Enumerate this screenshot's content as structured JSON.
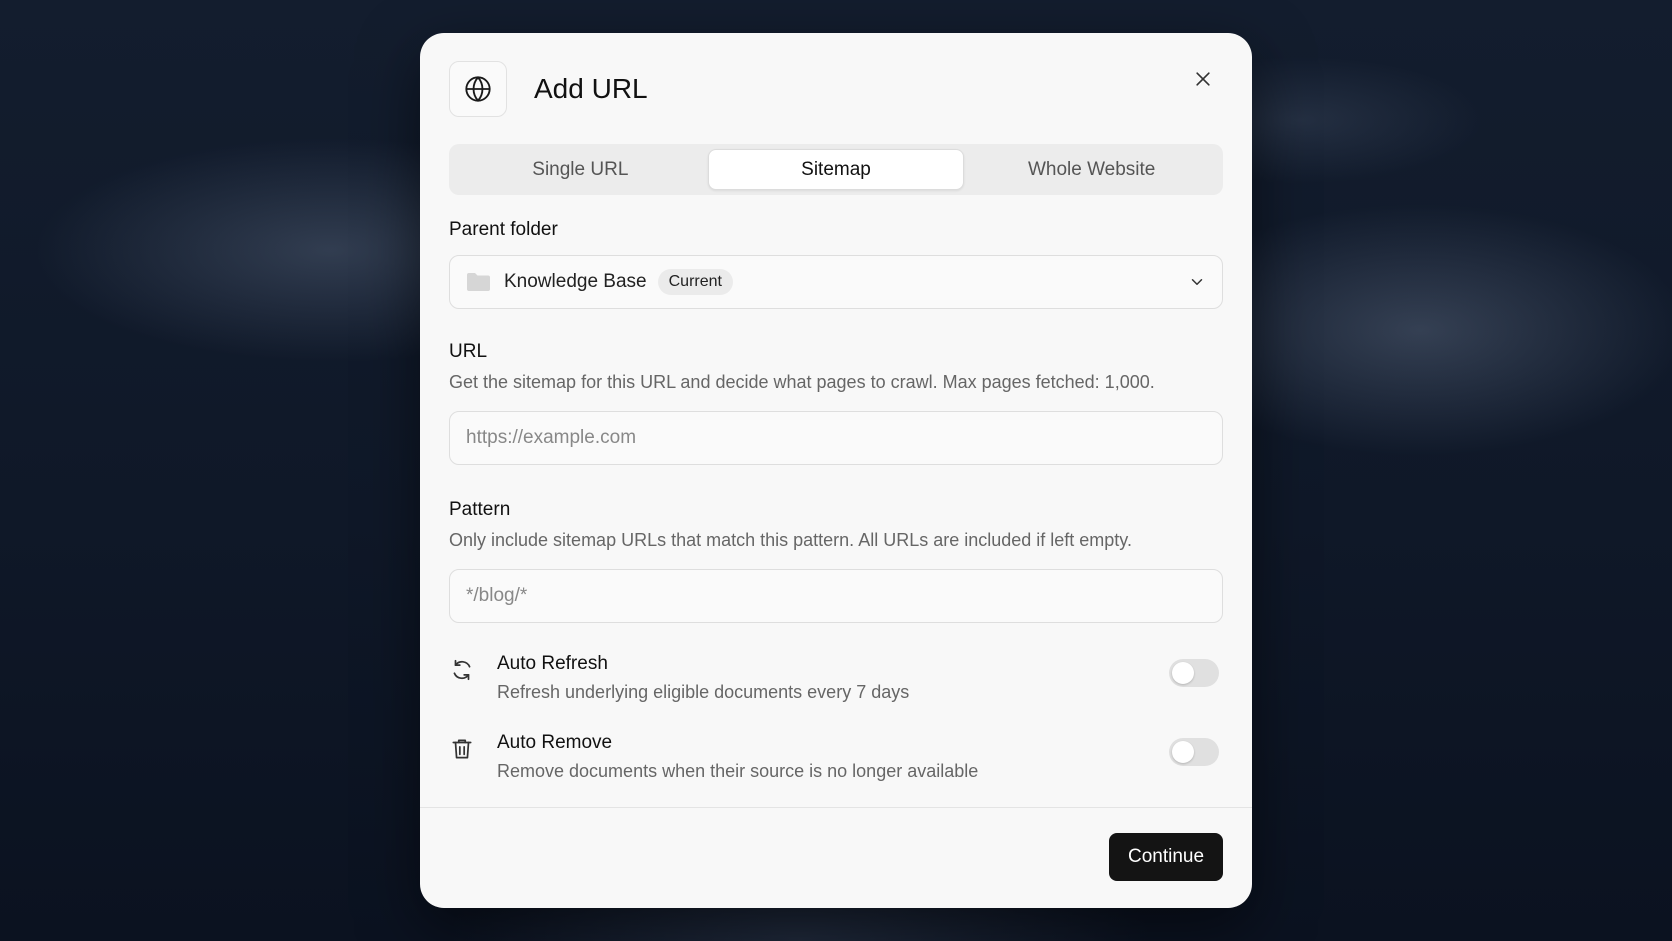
{
  "dialog": {
    "title": "Add URL",
    "icon": "globe-icon",
    "close_icon": "close-icon"
  },
  "tabs": [
    {
      "label": "Single URL",
      "active": false
    },
    {
      "label": "Sitemap",
      "active": true
    },
    {
      "label": "Whole Website",
      "active": false
    }
  ],
  "parent_folder": {
    "label": "Parent folder",
    "icon": "folder-icon",
    "value": "Knowledge Base",
    "badge": "Current"
  },
  "url": {
    "label": "URL",
    "description": "Get the sitemap for this URL and decide what pages to crawl. Max pages fetched: 1,000.",
    "placeholder": "https://example.com",
    "value": ""
  },
  "pattern": {
    "label": "Pattern",
    "description": "Only include sitemap URLs that match this pattern. All URLs are included if left empty.",
    "placeholder": "*/blog/*",
    "value": ""
  },
  "options": {
    "auto_refresh": {
      "icon": "refresh-icon",
      "title": "Auto Refresh",
      "description": "Refresh underlying eligible documents every 7 days",
      "enabled": false
    },
    "auto_remove": {
      "icon": "trash-icon",
      "title": "Auto Remove",
      "description": "Remove documents when their source is no longer available",
      "enabled": false
    }
  },
  "footer": {
    "continue_label": "Continue"
  },
  "colors": {
    "primary_button": "#141414",
    "dialog_bg": "#f8f8f8",
    "backdrop": "#0f1828"
  }
}
